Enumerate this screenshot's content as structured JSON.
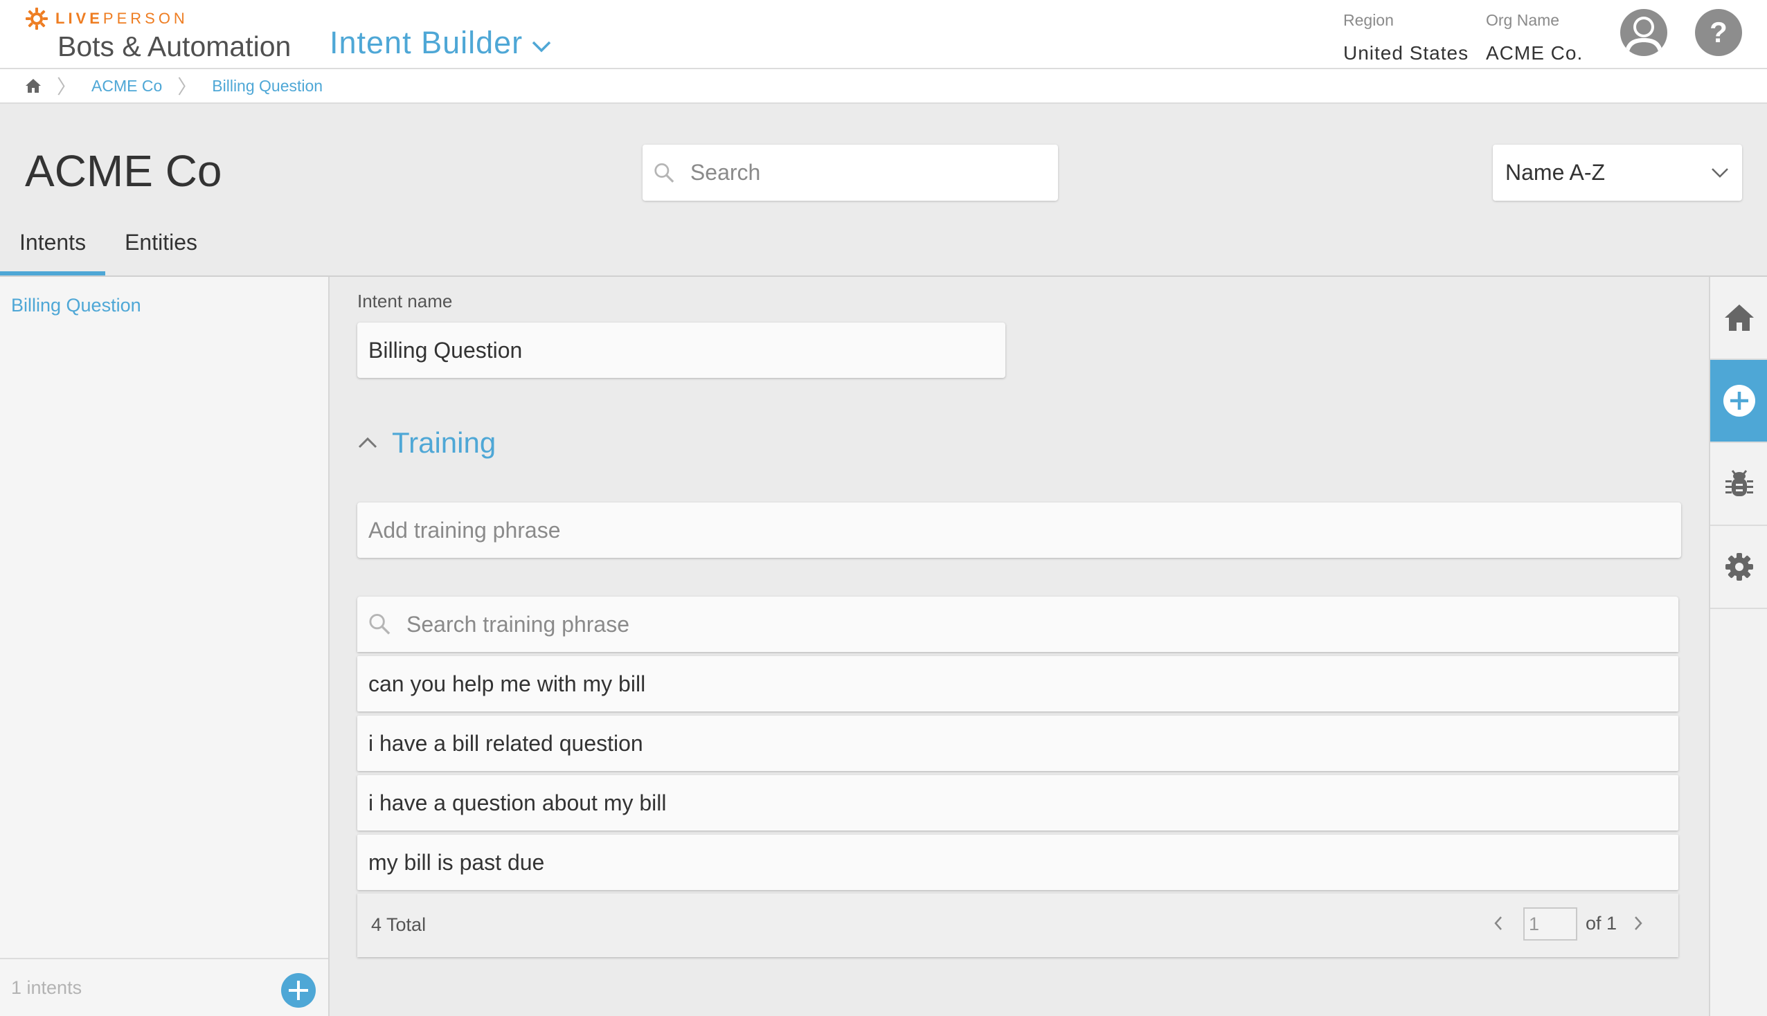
{
  "header": {
    "brand_bold": "LIVE",
    "brand_light": "PERSON",
    "product": "Bots & Automation",
    "module": "Intent Builder",
    "region_label": "Region",
    "region_value": "United States",
    "org_label": "Org Name",
    "org_value": "ACME Co.",
    "help_glyph": "?"
  },
  "breadcrumb": {
    "items": [
      "ACME Co",
      "Billing Question"
    ],
    "separator": "〉"
  },
  "page": {
    "title": "ACME Co",
    "search_placeholder": "Search",
    "sort_value": "Name A-Z"
  },
  "tabs": [
    {
      "label": "Intents",
      "active": true
    },
    {
      "label": "Entities",
      "active": false
    }
  ],
  "intents": {
    "items": [
      "Billing Question"
    ],
    "count_text": "1 intents"
  },
  "editor": {
    "intent_name_label": "Intent name",
    "intent_name_value": "Billing Question",
    "training_title": "Training",
    "add_phrase_placeholder": "Add training phrase",
    "search_phrase_placeholder": "Search training phrase",
    "phrases": [
      "can you help me with my bill",
      "i have a bill related question",
      "i have a question about my bill",
      "my bill is past due"
    ],
    "total_text": "4 Total",
    "page_value": "1",
    "page_of": "of 1"
  },
  "rail": {
    "items": [
      {
        "icon": "home-icon"
      },
      {
        "icon": "add-circle-icon",
        "active": true
      },
      {
        "icon": "bug-icon"
      },
      {
        "icon": "gear-icon"
      }
    ]
  },
  "colors": {
    "accent": "#4ea7d6",
    "brand_orange": "#ee7d22",
    "background": "#ebebeb"
  }
}
